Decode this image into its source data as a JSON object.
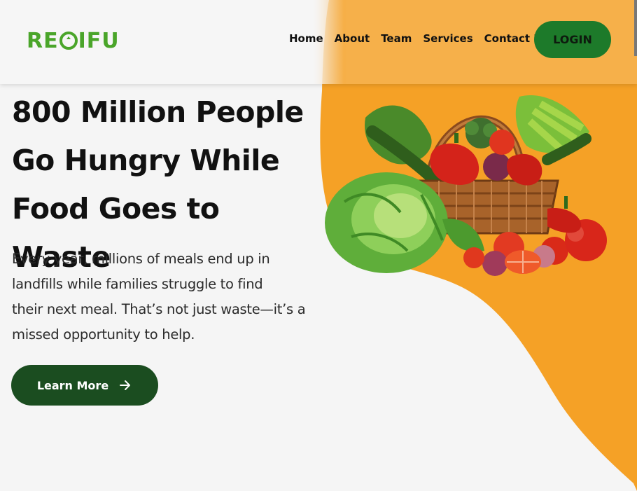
{
  "brand": {
    "logo_text_left": "RE",
    "logo_text_right": "IFU",
    "brand_green": "#4aa52a",
    "recycle_icon": "recycle-icon"
  },
  "nav": {
    "items": [
      "Home",
      "About",
      "Team",
      "Services",
      "Contact Us"
    ],
    "login_label": "LOGIN"
  },
  "hero": {
    "title_lines": [
      "800 Million People",
      "Go Hungry While",
      "Food Goes to Waste"
    ],
    "subtitle_lines": [
      "Every year, millions of meals end up in",
      "landfills while families struggle to find",
      "their next meal. That’s not just waste—it’s a",
      "missed opportunity to help."
    ],
    "cta_label": "Learn More",
    "cta_icon": "arrow-right-icon"
  },
  "colors": {
    "accent_orange": "#f5a126",
    "dark_green": "#1b4d20",
    "login_green": "#1d7a2a",
    "background": "#f5f5f5"
  }
}
